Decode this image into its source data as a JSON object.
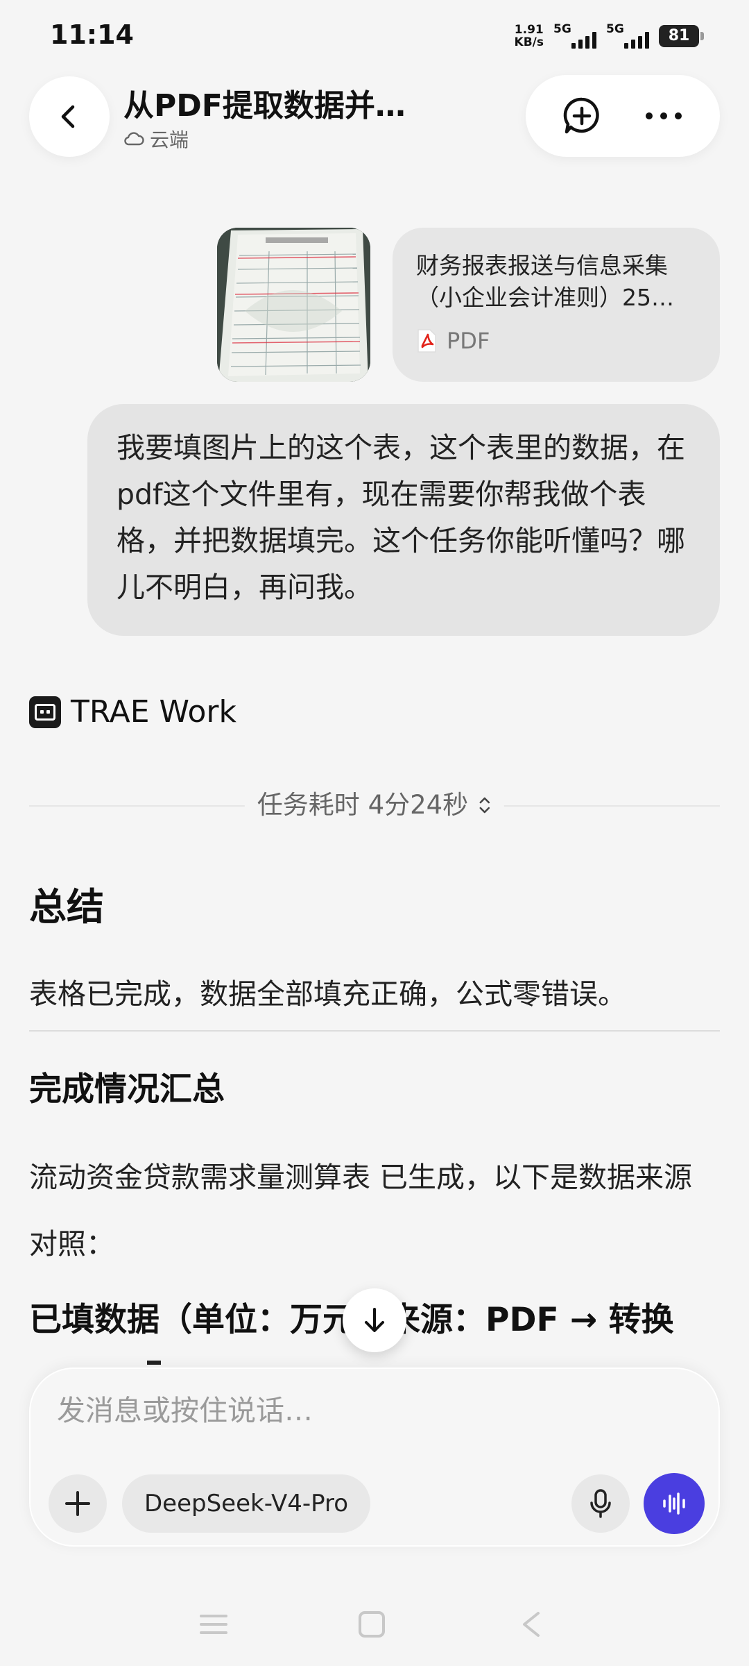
{
  "status_bar": {
    "time": "11:14",
    "net_speed_value": "1.91",
    "net_speed_unit": "KB/s",
    "sim1_label": "5G",
    "sim2_label": "5G",
    "battery": "81"
  },
  "header": {
    "title": "从PDF提取数据并…",
    "subtitle": "云端",
    "back_icon": "chevron-left-icon",
    "new_chat_icon": "chat-plus-icon",
    "more_icon": "more-horizontal-icon"
  },
  "attachments": {
    "image_icon": "document-photo",
    "pdf_name": "财务报表报送与信息采集（小企业会计准则）25…",
    "pdf_type": "PDF",
    "pdf_icon": "pdf-icon"
  },
  "user_message": "我要填图片上的这个表，这个表里的数据，在pdf这个文件里有，现在需要你帮我做个表格，并把数据填完。这个任务你能听懂吗？哪儿不明白，再问我。",
  "agent": {
    "name": "TRAE Work",
    "duration": "任务耗时 4分24秒"
  },
  "response": {
    "summary_title": "总结",
    "summary_text": "表格已完成，数据全部填充正确，公式零错误。",
    "done_title": "完成情况汇总",
    "done_text": "流动资金贷款需求量测算表 已生成，以下是数据来源对照：",
    "filled_title": "已填数据（单位：万元，来源：PDF → 转换"
  },
  "composer": {
    "placeholder": "发消息或按住说话…",
    "model": "DeepSeek-V4-Pro"
  },
  "colors": {
    "accent": "#4a3ee0",
    "background": "#f5f5f5",
    "bubble": "#e4e4e4"
  }
}
